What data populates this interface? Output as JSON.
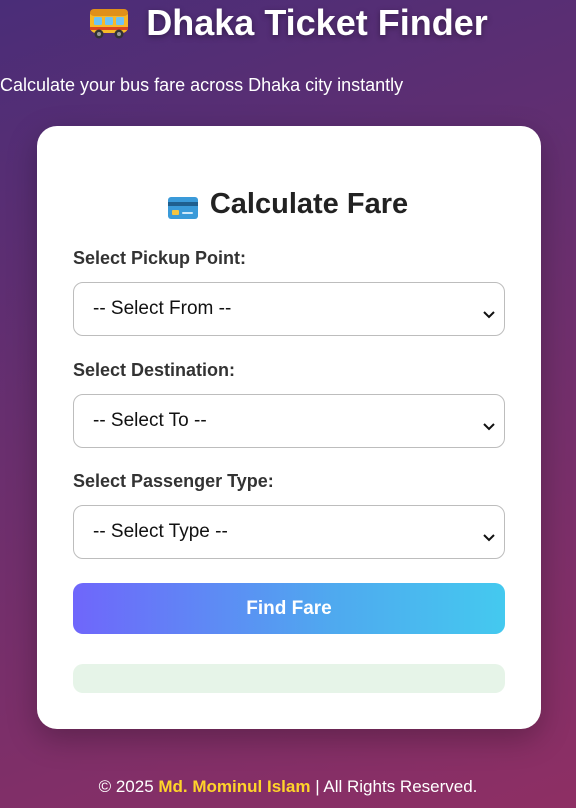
{
  "header": {
    "title": "Dhaka Ticket Finder",
    "subtitle": "Calculate your bus fare across Dhaka city instantly",
    "icon": "bus-icon"
  },
  "card": {
    "title": "Calculate Fare",
    "icon": "credit-card-icon",
    "pickup": {
      "label": "Select Pickup Point:",
      "value": "-- Select From --"
    },
    "destination": {
      "label": "Select Destination:",
      "value": "-- Select To --"
    },
    "passenger": {
      "label": "Select Passenger Type:",
      "value": "-- Select Type --"
    },
    "button_label": "Find Fare"
  },
  "footer": {
    "prefix": "© 2025",
    "author": "Md. Mominul Islam",
    "suffix": "| All Rights Reserved."
  },
  "colors": {
    "button_gradient_start": "#6f66fb",
    "button_gradient_end": "#44c9ef",
    "author_highlight": "#ffd42a",
    "result_background": "#e6f4e8"
  }
}
